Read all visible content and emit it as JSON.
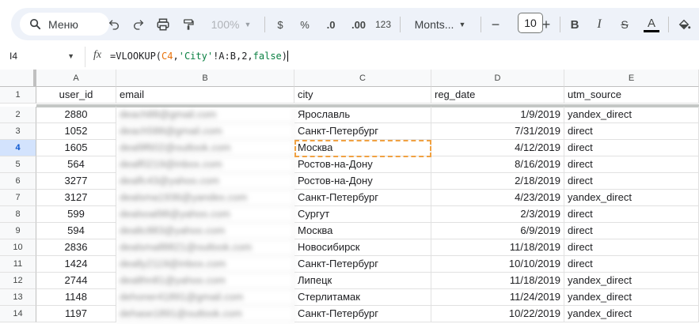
{
  "toolbar": {
    "menu_label": "Меню",
    "zoom": "100%",
    "currency": "$",
    "percent": "%",
    "dec_decrease": ".0",
    "dec_increase": ".00",
    "format_123": "123",
    "font_name": "Monts...",
    "font_size": "10",
    "minus": "−",
    "plus": "+",
    "bold": "B",
    "italic": "I",
    "strike": "S",
    "text_color": "A"
  },
  "formula_bar": {
    "cell_ref": "I4",
    "fx": "fx",
    "formula_prefix": "=VLOOKUP(",
    "formula_ref": "C4",
    "formula_comma": ",",
    "formula_str": "'City'",
    "formula_rest": "!A:B,2,",
    "formula_false": "false",
    "formula_close": ")"
  },
  "columns": [
    "A",
    "B",
    "C",
    "D",
    "E"
  ],
  "headers": {
    "row": "1",
    "A": "user_id",
    "B": "email",
    "C": "city",
    "D": "reg_date",
    "E": "utm_source"
  },
  "rows": [
    {
      "n": "2",
      "A": "2880",
      "B": "deach88@gmail.com",
      "C": "Ярославль",
      "D": "1/9/2019",
      "E": "yandex_direct"
    },
    {
      "n": "3",
      "A": "1052",
      "B": "deach588@gmail.com",
      "C": "Санкт-Петербург",
      "D": "7/31/2019",
      "E": "direct"
    },
    {
      "n": "4",
      "A": "1605",
      "B": "deal9f602@outlook.com",
      "C": "Москва",
      "D": "4/12/2019",
      "E": "direct"
    },
    {
      "n": "5",
      "A": "564",
      "B": "dealf0219@inbox.com",
      "C": "Ростов-на-Дону",
      "D": "8/16/2019",
      "E": "direct"
    },
    {
      "n": "6",
      "A": "3277",
      "B": "dealfc43@yahoo.com",
      "C": "Ростов-на-Дону",
      "D": "2/18/2019",
      "E": "direct"
    },
    {
      "n": "7",
      "A": "3127",
      "B": "dealsma1936@yandex.com",
      "C": "Санкт-Петербург",
      "D": "4/23/2019",
      "E": "yandex_direct"
    },
    {
      "n": "8",
      "A": "599",
      "B": "dealsoal98@yahoo.com",
      "C": "Сургут",
      "D": "2/3/2019",
      "E": "direct"
    },
    {
      "n": "9",
      "A": "594",
      "B": "dealtc883@yahoo.com",
      "C": "Москва",
      "D": "6/9/2019",
      "E": "direct"
    },
    {
      "n": "10",
      "A": "2836",
      "B": "dealsmall8821@outlook.com",
      "C": "Новосибирск",
      "D": "11/18/2019",
      "E": "direct"
    },
    {
      "n": "11",
      "A": "1424",
      "B": "deally2119@inbox.com",
      "C": "Санкт-Петербург",
      "D": "10/10/2019",
      "E": "direct"
    },
    {
      "n": "12",
      "A": "2744",
      "B": "dealthn81@yahoo.com",
      "C": "Липецк",
      "D": "11/18/2019",
      "E": "yandex_direct"
    },
    {
      "n": "13",
      "A": "1148",
      "B": "dehoner41891@gmail.com",
      "C": "Стерлитамак",
      "D": "11/24/2019",
      "E": "yandex_direct"
    },
    {
      "n": "14",
      "A": "1197",
      "B": "dehase1891@outlook.com",
      "C": "Санкт-Петербург",
      "D": "10/22/2019",
      "E": "yandex_direct"
    }
  ],
  "colors": {
    "accent": "#0b57d0",
    "selection_border": "#f0a142",
    "ref": "#e8710a",
    "string": "#0b8043"
  }
}
